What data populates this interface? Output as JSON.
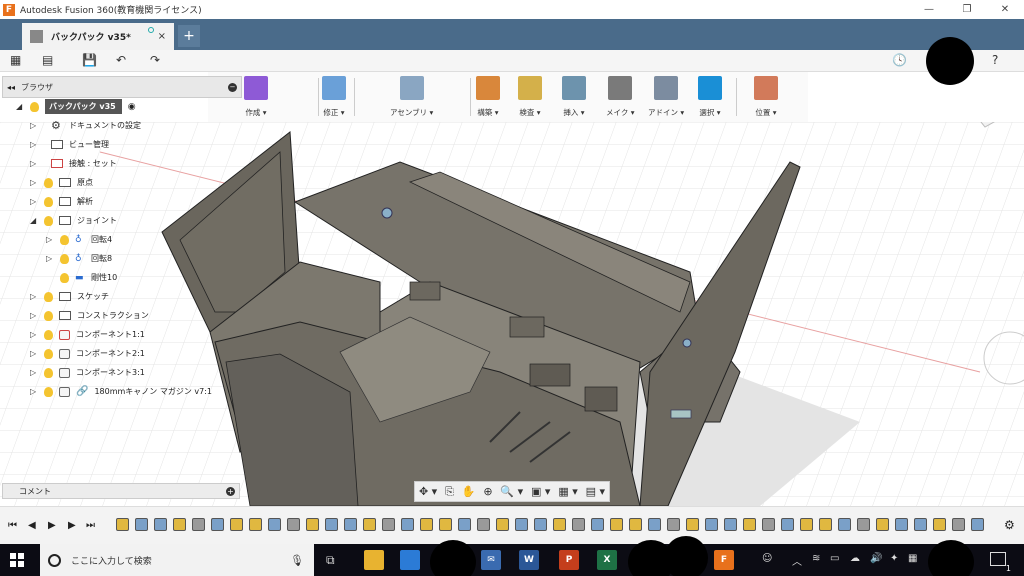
{
  "window": {
    "app_title": "Autodesk Fusion 360(教育機関ライセンス)",
    "logo_letter": "F",
    "minimize": "—",
    "restore": "❐",
    "close": "✕"
  },
  "tabs": [
    {
      "name": "バックパック v35*",
      "close": "×"
    }
  ],
  "new_tab": "+",
  "qat": {
    "grid_icon": "▦",
    "file_icon": "▤",
    "save_icon": "💾",
    "undo_icon": "↶",
    "redo_icon": "↷",
    "clock_icon": "🕓",
    "help_icon": "?"
  },
  "ribbon": [
    {
      "label": "作成 ▾",
      "icon": "create-form-icon",
      "color": "#7b3fd6"
    },
    {
      "label": "修正 ▾",
      "icon": "modify-icon",
      "color": "#4a86c8"
    },
    {
      "label": "アセンブリ ▾",
      "icon": "assemble-icon",
      "color": "#5e7a99"
    },
    {
      "label": "構築 ▾",
      "icon": "construct-icon",
      "color": "#d97b2b"
    },
    {
      "label": "検査 ▾",
      "icon": "inspect-icon",
      "color": "#c8a23a"
    },
    {
      "label": "挿入 ▾",
      "icon": "insert-icon",
      "color": "#4f7a9a"
    },
    {
      "label": "メイク ▾",
      "icon": "make-icon",
      "color": "#5a5a5a"
    },
    {
      "label": "アドイン ▾",
      "icon": "addins-icon",
      "color": "#5a6b80"
    },
    {
      "label": "選択 ▾",
      "icon": "select-icon",
      "color": "#1a8fd6"
    },
    {
      "label": "位置 ▾",
      "icon": "position-icon",
      "color": "#c85a3a"
    }
  ],
  "browser": {
    "collapse": "◂◂",
    "title": "ブラウザ",
    "root": "バックパック v35",
    "items": [
      {
        "label": "ドキュメントの設定",
        "icon": "gear",
        "bulb": false,
        "indent": 0
      },
      {
        "label": "ビュー管理",
        "icon": "folder",
        "bulb": false,
        "indent": 0
      },
      {
        "label": "接触 : セット",
        "icon": "contact",
        "bulb": false,
        "indent": 0
      },
      {
        "label": "原点",
        "icon": "folder",
        "bulb": true,
        "indent": 0
      },
      {
        "label": "解析",
        "icon": "folder",
        "bulb": true,
        "indent": 0
      },
      {
        "label": "ジョイント",
        "icon": "folder",
        "bulb": true,
        "indent": 0
      },
      {
        "label": "回転4",
        "icon": "joint",
        "bulb": true,
        "indent": 1
      },
      {
        "label": "回転8",
        "icon": "joint",
        "bulb": true,
        "indent": 1
      },
      {
        "label": "剛性10",
        "icon": "rigid",
        "bulb": true,
        "indent": 1
      },
      {
        "label": "スケッチ",
        "icon": "folder",
        "bulb": true,
        "indent": 0
      },
      {
        "label": "コンストラクション",
        "icon": "folder",
        "bulb": true,
        "indent": 0
      },
      {
        "label": "コンポーネント1:1",
        "icon": "comp",
        "bulb": true,
        "indent": 0
      },
      {
        "label": "コンポーネント2:1",
        "icon": "comp",
        "bulb": true,
        "indent": 0
      },
      {
        "label": "コンポーネント3:1",
        "icon": "comp",
        "bulb": true,
        "indent": 0
      },
      {
        "label": "180mmキャノン マガジン v7:1",
        "icon": "link",
        "bulb": true,
        "indent": 0
      }
    ]
  },
  "comments": {
    "label": "コメント",
    "plus": "+"
  },
  "navbar": [
    "✥ ▾",
    "⎘",
    "✋",
    "⊕",
    "🔍 ▾",
    "▣ ▾",
    "▦ ▾",
    "▤ ▾"
  ],
  "timeline": {
    "first": "⏮",
    "prev": "◀",
    "play": "▶",
    "next": "▶",
    "last": "⏭",
    "settings": "⚙"
  },
  "taskbar": {
    "search_placeholder": "ここに入力して検索",
    "mic": "🎙",
    "word_letter": "W",
    "ppt_letter": "P",
    "excel_letter": "X",
    "fusion_letter": "F",
    "notification": "1"
  }
}
